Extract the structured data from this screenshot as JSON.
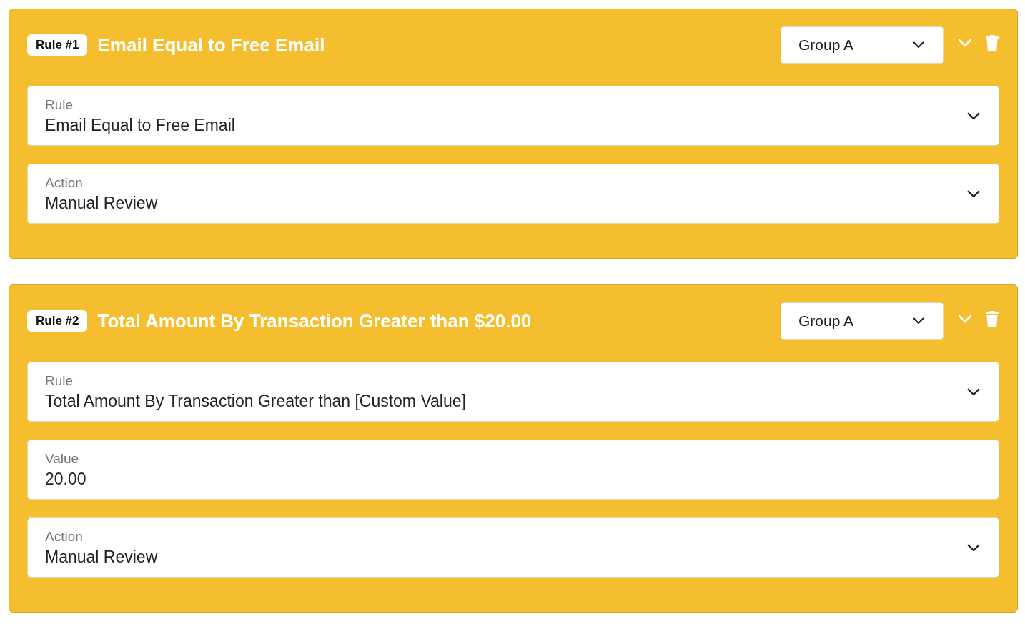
{
  "rules": [
    {
      "badge": "Rule #1",
      "title": "Email Equal to Free Email",
      "group": {
        "value": "Group A"
      },
      "fields": [
        {
          "kind": "select",
          "label": "Rule",
          "value": "Email Equal to Free Email"
        },
        {
          "kind": "select",
          "label": "Action",
          "value": "Manual Review"
        }
      ]
    },
    {
      "badge": "Rule #2",
      "title": "Total Amount By Transaction Greater than $20.00",
      "group": {
        "value": "Group A"
      },
      "fields": [
        {
          "kind": "select",
          "label": "Rule",
          "value": "Total Amount By Transaction Greater than [Custom Value]"
        },
        {
          "kind": "input",
          "label": "Value",
          "value": "20.00"
        },
        {
          "kind": "select",
          "label": "Action",
          "value": "Manual Review"
        }
      ]
    }
  ]
}
